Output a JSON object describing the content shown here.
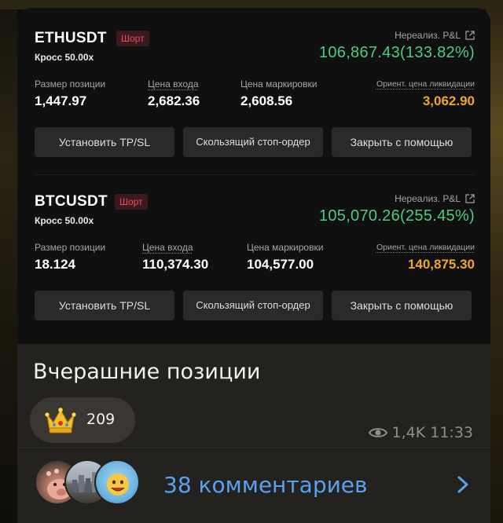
{
  "positions": [
    {
      "pair": "ETHUSDT",
      "side_badge": "Шорт",
      "margin_mode": "Кросс 50.00x",
      "pnl_label": "Нереализ. P&L",
      "pnl_value": "106,867.43(133.82%)",
      "size_label": "Размер позиции",
      "size_value": "1,447.97",
      "entry_label": "Цена входа",
      "entry_value": "2,682.36",
      "mark_label": "Цена маркировки",
      "mark_value": "2,608.56",
      "liq_label": "Ориент. цена ликвидации",
      "liq_value": "3,062.90",
      "btn_tpsl": "Установить TP/SL",
      "btn_trailing": "Скользящий стоп-ордер",
      "btn_close": "Закрыть с помощью"
    },
    {
      "pair": "BTCUSDT",
      "side_badge": "Шорт",
      "margin_mode": "Кросс 50.00x",
      "pnl_label": "Нереализ. P&L",
      "pnl_value": "105,070.26(255.45%)",
      "size_label": "Размер позиции",
      "size_value": "18.124",
      "entry_label": "Цена входа",
      "entry_value": "110,374.30",
      "mark_label": "Цена маркировки",
      "mark_value": "104,577.00",
      "liq_label": "Ориент. цена ликвидации",
      "liq_value": "140,875.30",
      "btn_tpsl": "Установить TP/SL",
      "btn_trailing": "Скользящий стоп-ордер",
      "btn_close": "Закрыть с помощью"
    }
  ],
  "message": {
    "caption": "Вчерашние позиции",
    "reaction_icon": "crown-icon",
    "reaction_count": "209",
    "views": "1,4K",
    "time": "11:33"
  },
  "comments": {
    "label": "38 комментариев"
  },
  "colors": {
    "pnl_green": "#4fcb7f",
    "short_red": "#f04a5a",
    "liq_orange": "#f0a52b",
    "link_blue": "#5aa0f0"
  }
}
